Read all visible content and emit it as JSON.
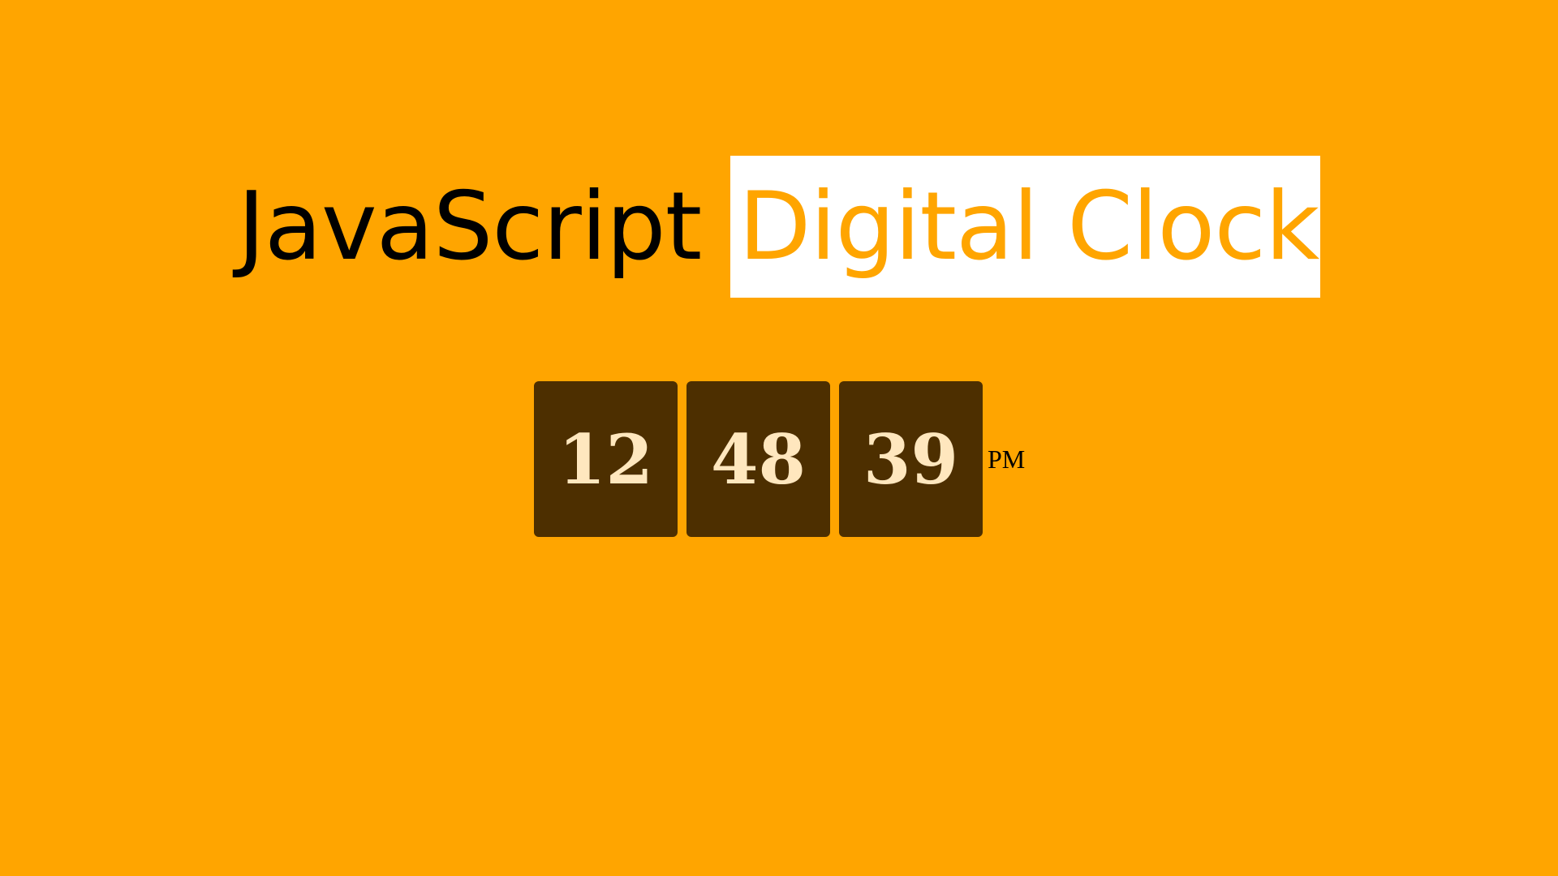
{
  "title": {
    "main": "JavaScript",
    "highlight": "Digital Clock"
  },
  "clock": {
    "hours": "12",
    "minutes": "48",
    "seconds": "39",
    "ampm": "PM"
  },
  "colors": {
    "background": "#FFA500",
    "title_text": "#000000",
    "highlight_bg": "#FFFFFF",
    "highlight_text": "#FFA500",
    "digit_box_bg": "#4D2F00",
    "digit_text": "#FFE7BE"
  }
}
